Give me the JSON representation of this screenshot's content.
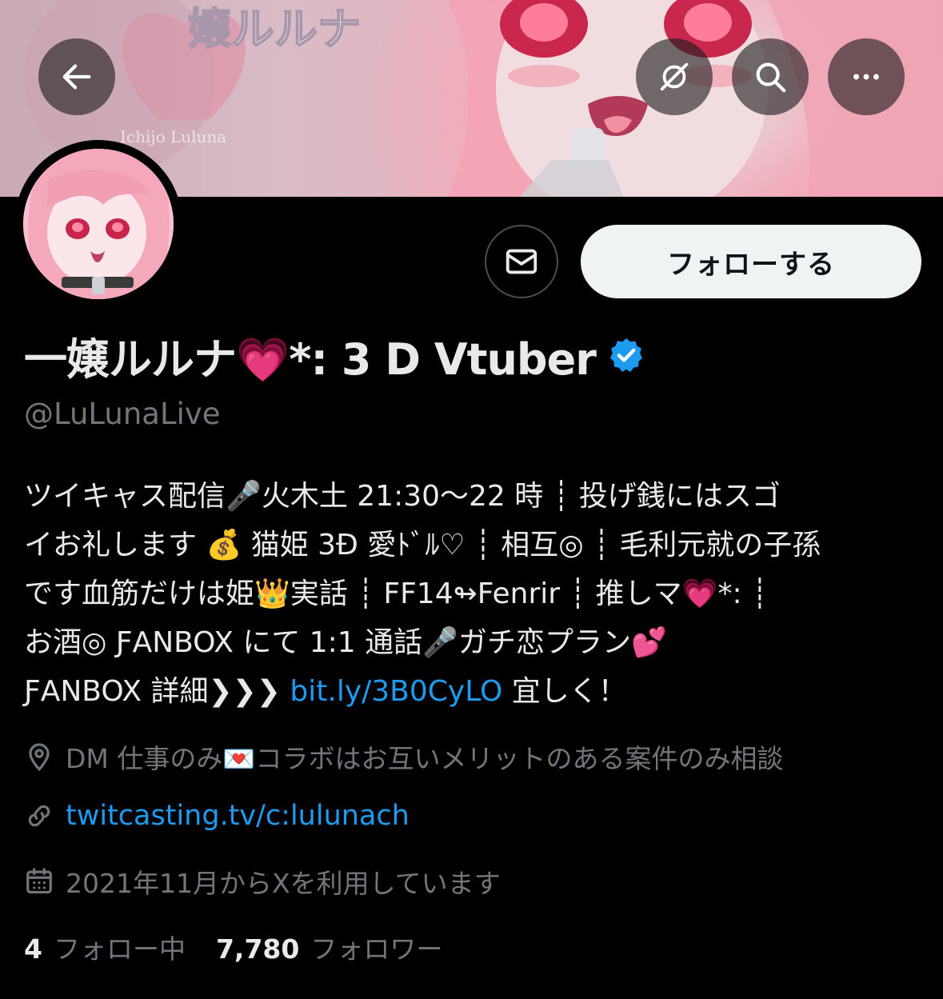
{
  "banner": {
    "logo_text": "嬢ルルナ",
    "logo_subtext": "Ichijo Luluna"
  },
  "top_bar": {
    "back_icon": "arrow-left-icon",
    "notify_icon": "bell-off-icon",
    "search_icon": "search-icon",
    "more_icon": "more-horizontal-icon"
  },
  "profile": {
    "display_name": "一嬢ルルナ💗*:  3 D Vtuber",
    "verified_color": "#1d9bf0",
    "handle": "@LuLunaLive",
    "message_icon": "envelope-icon",
    "follow_label": "フォローする"
  },
  "bio": {
    "lines": [
      "ツイキャス配信🎤火木土 21:30～22 時 ┊ 投げ銭にはスゴ",
      "イお礼します 💰 猫姫 3Ð 愛ﾄﾞﾙ♡ ┊ 相互◎ ┊ 毛利元就の子孫",
      "です血筋だけは姫👑実話 ┊ FF14↬Fenrir ┊ 推しマ💗*:  ┊",
      "お酒◎ ƑANBOX にて 1:1 通話🎤ガチ恋プラン💕",
      "ƑANBOX 詳細❯❯❯ "
    ],
    "link_text": "bit.ly/3B0CyLO",
    "link_suffix": " 宜しく！"
  },
  "meta": {
    "location_icon": "location-pin-icon",
    "location_text": "DM 仕事のみ💌コラボはお互いメリットのある案件のみ相談",
    "link_icon": "link-icon",
    "website": "twitcasting.tv/c:lulunach",
    "calendar_icon": "calendar-icon",
    "joined": "2021年11月からXを利用しています"
  },
  "stats": {
    "following_count": "4",
    "following_label": "フォロー中",
    "followers_count": "7,780",
    "followers_label": "フォロワー"
  },
  "colors": {
    "background": "#000000",
    "text": "#e7e9ea",
    "muted": "#71767b",
    "link": "#1d9bf0",
    "follow_button_bg": "#eff3f4"
  }
}
